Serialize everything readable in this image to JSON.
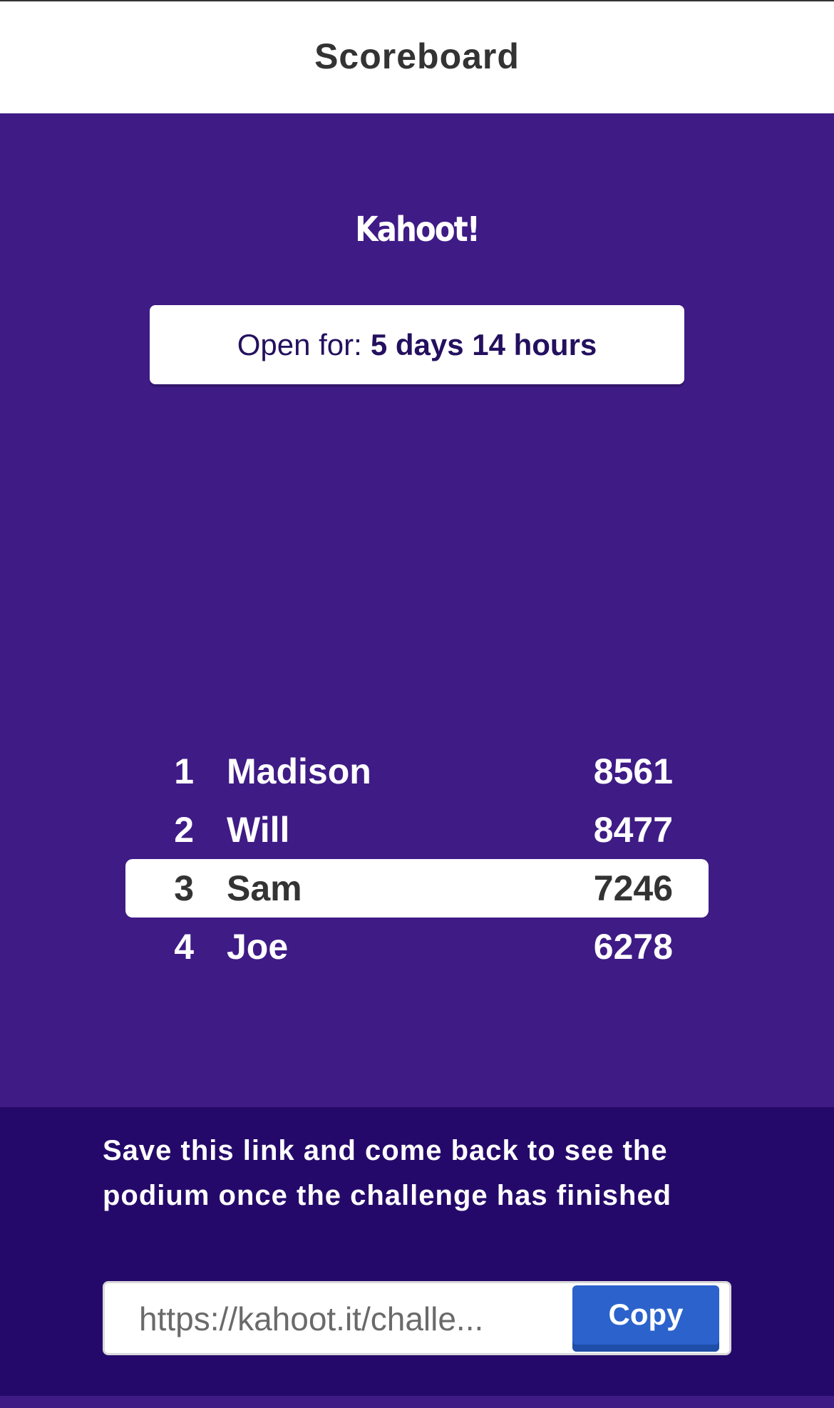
{
  "header": {
    "title": "Scoreboard"
  },
  "brand": {
    "logo_text": "Kahoot!"
  },
  "timer": {
    "label": "Open for:",
    "value": "5 days 14 hours"
  },
  "scoreboard": {
    "rows": [
      {
        "rank": "1",
        "name": "Madison",
        "score": "8561",
        "highlighted": false
      },
      {
        "rank": "2",
        "name": "Will",
        "score": "8477",
        "highlighted": false
      },
      {
        "rank": "3",
        "name": "Sam",
        "score": "7246",
        "highlighted": true
      },
      {
        "rank": "4",
        "name": "Joe",
        "score": "6278",
        "highlighted": false
      }
    ]
  },
  "footer": {
    "message": "Save this link and come back to see the podium once the challenge has finished",
    "link_value": "https://kahoot.it/challe...",
    "copy_label": "Copy"
  },
  "colors": {
    "main_background": "#3f1b86",
    "footer_background": "#25096a",
    "copy_button": "#2b62cc",
    "header_text": "#333333"
  }
}
